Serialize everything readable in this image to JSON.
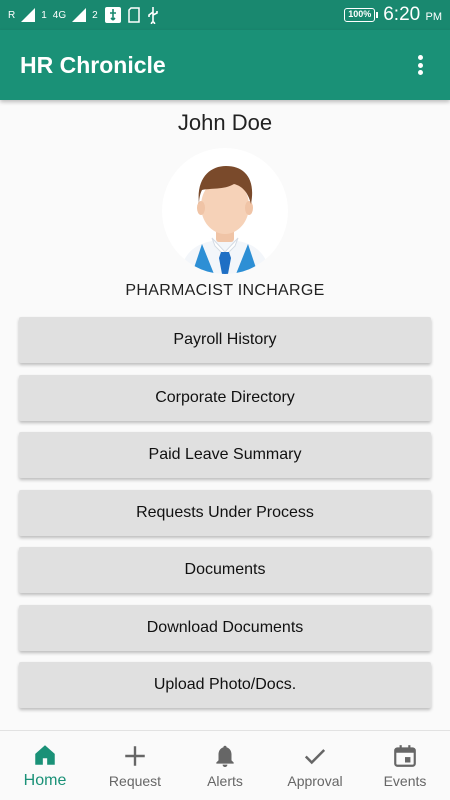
{
  "status_bar": {
    "carrier_mark": "R",
    "network": "4G",
    "sim_1": "1",
    "sim_2": "2",
    "battery": "100%",
    "time": "6:20",
    "ampm": "PM"
  },
  "app_bar": {
    "title": "HR Chronicle"
  },
  "profile": {
    "name": "John Doe",
    "designation": "PHARMACIST INCHARGE"
  },
  "menu": [
    {
      "label": "Payroll History"
    },
    {
      "label": "Corporate Directory"
    },
    {
      "label": "Paid Leave Summary"
    },
    {
      "label": "Requests Under Process"
    },
    {
      "label": "Documents"
    },
    {
      "label": "Download Documents"
    },
    {
      "label": "Upload Photo/Docs."
    }
  ],
  "bottom_nav": [
    {
      "label": "Home",
      "icon": "home-icon",
      "active": true
    },
    {
      "label": "Request",
      "icon": "plus-icon",
      "active": false
    },
    {
      "label": "Alerts",
      "icon": "bell-icon",
      "active": false
    },
    {
      "label": "Approval",
      "icon": "check-icon",
      "active": false
    },
    {
      "label": "Events",
      "icon": "calendar-icon",
      "active": false
    }
  ],
  "colors": {
    "status_bar": "#19886f",
    "primary": "#1a9177",
    "button_bg": "#e0e0e0",
    "inactive": "#666666"
  }
}
